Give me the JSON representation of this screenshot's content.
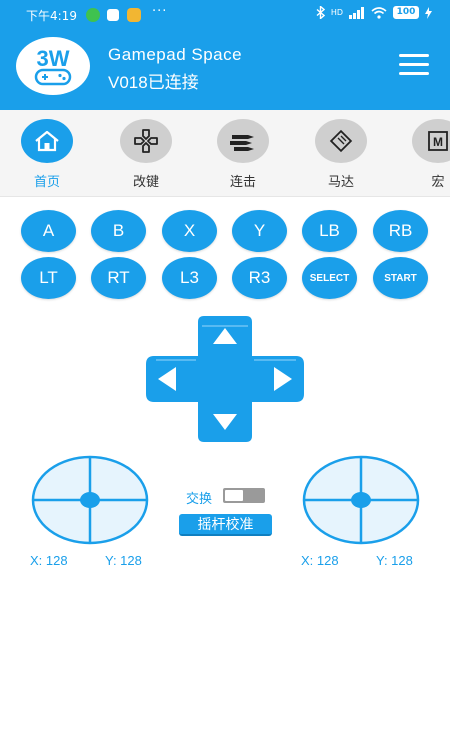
{
  "status_bar": {
    "time": "下午4:19",
    "more": "···",
    "signal": "HD",
    "battery": "100"
  },
  "header": {
    "title": "Gamepad Space",
    "subtitle": "V018已连接",
    "logo_text": "3W"
  },
  "nav": {
    "items": [
      {
        "label": "首页",
        "icon": "home-icon",
        "active": true
      },
      {
        "label": "改键",
        "icon": "gamepad-icon",
        "active": false
      },
      {
        "label": "连击",
        "icon": "bullets-icon",
        "active": false
      },
      {
        "label": "马达",
        "icon": "motor-chip-icon",
        "active": false
      },
      {
        "label": "宏",
        "icon": "macro-m-icon",
        "active": false
      }
    ]
  },
  "buttons": {
    "row1": [
      "A",
      "B",
      "X",
      "Y",
      "LB",
      "RB"
    ],
    "row2": [
      "LT",
      "RT",
      "L3",
      "R3",
      "SELECT",
      "START"
    ]
  },
  "swap": {
    "label": "交换",
    "on": false
  },
  "calibrate_label": "摇杆校准",
  "left_stick": {
    "x_label": "X: 128",
    "y_label": "Y: 128"
  },
  "right_stick": {
    "x_label": "X: 128",
    "y_label": "Y: 128"
  },
  "colors": {
    "accent": "#1a9fea",
    "nav_bg": "#f5f5f5",
    "inactive_icon_bg": "#cfcfcf",
    "joystick_fill": "#e6f4fd"
  }
}
